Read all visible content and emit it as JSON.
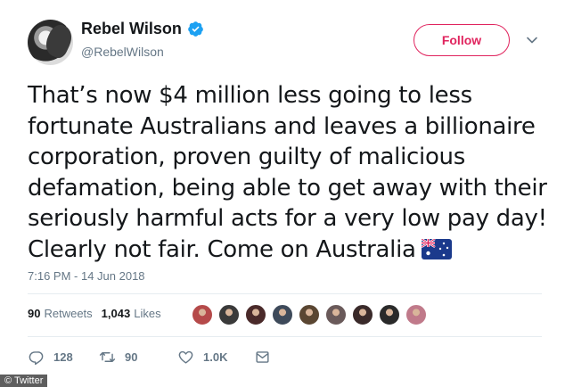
{
  "user": {
    "display_name": "Rebel Wilson",
    "handle": "@RebelWilson",
    "verified_icon": "verified-badge-icon",
    "avatar_icon": "avatar"
  },
  "follow_button": {
    "label": "Follow"
  },
  "tweet": {
    "lines": [
      "That’s now $4 million less going to less",
      "fortunate Australians and leaves a billionaire",
      "corporation, proven guilty of malicious",
      "defamation, being able to get away with their",
      "seriously harmful acts for a very low pay day!",
      "Clearly not fair. Come on Australia"
    ],
    "emoji": "australia-flag-icon",
    "timestamp": "7:16 PM - 14 Jun 2018"
  },
  "stats": {
    "retweets_count": "90",
    "retweets_label": "Retweets",
    "likes_count": "1,043",
    "likes_label": "Likes",
    "liker_avatar_colors": [
      "#b54a4a",
      "#3a3a3a",
      "#4a2a2a",
      "#3e4a5a",
      "#5a4632",
      "#6a5a5a",
      "#3a2a2a",
      "#2a2a2a",
      "#c07a8a"
    ]
  },
  "actions": {
    "reply_count": "128",
    "retweet_count": "90",
    "like_count": "1.0K"
  },
  "credit": "© Twitter",
  "colors": {
    "accent_follow": "#e0245e",
    "text_secondary": "#657786",
    "verified_blue": "#1da1f2"
  }
}
